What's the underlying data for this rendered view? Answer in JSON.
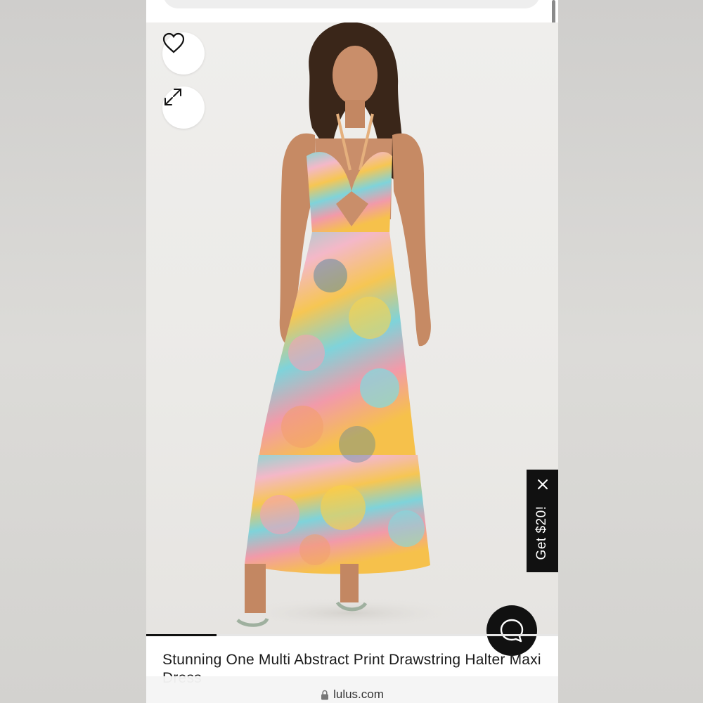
{
  "page": {
    "background_color": "#d8d7d5",
    "accent_color": "#111111"
  },
  "product": {
    "title": "Stunning One Multi Abstract Print Drawstring Halter Maxi Dress",
    "image_progress": 0.17
  },
  "icons": {
    "favorite": "heart-outline-icon",
    "expand": "expand-arrows-icon",
    "promo_close": "close-icon",
    "chat": "chat-bubble-icon",
    "lock": "lock-icon"
  },
  "promo": {
    "label": "Get $20!"
  },
  "browser": {
    "url": "lulus.com"
  }
}
